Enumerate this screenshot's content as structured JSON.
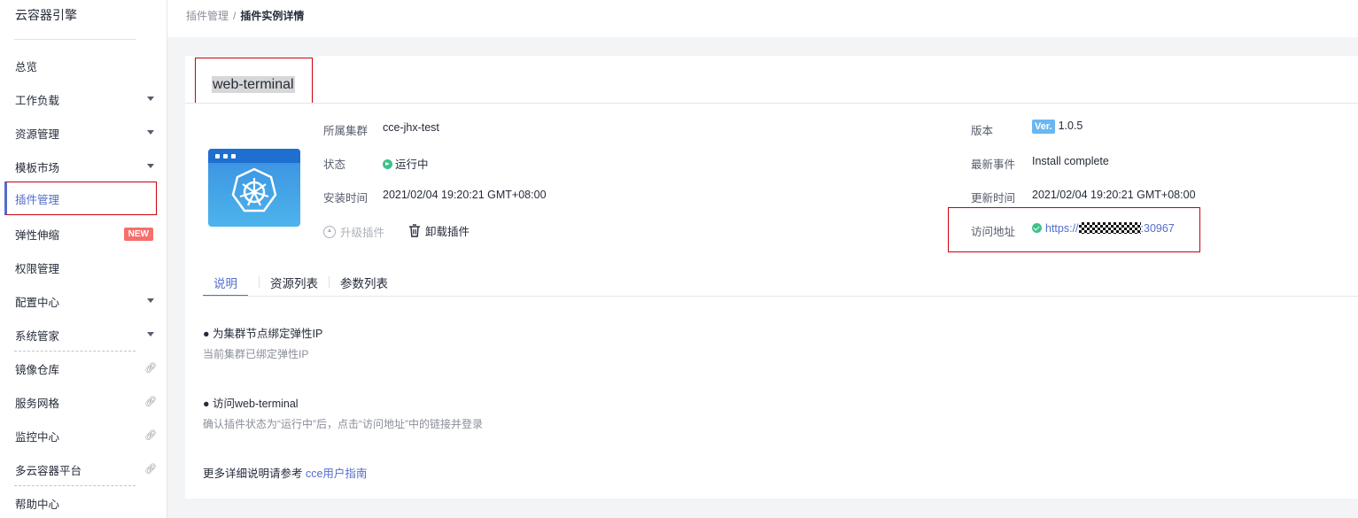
{
  "sidebar": {
    "title": "云容器引擎",
    "items": [
      {
        "label": "总览"
      },
      {
        "label": "工作负载"
      },
      {
        "label": "资源管理"
      },
      {
        "label": "模板市场"
      },
      {
        "label": "插件管理"
      },
      {
        "label": "弹性伸缩",
        "badge": "NEW"
      },
      {
        "label": "权限管理"
      },
      {
        "label": "配置中心"
      },
      {
        "label": "系统管家"
      },
      {
        "label": "镜像仓库"
      },
      {
        "label": "服务网格"
      },
      {
        "label": "监控中心"
      },
      {
        "label": "多云容器平台"
      },
      {
        "label": "帮助中心"
      }
    ]
  },
  "breadcrumb": {
    "parent": "插件管理",
    "separator": "/",
    "current": "插件实例详情"
  },
  "plugin": {
    "name": "web-terminal",
    "cluster_label": "所属集群",
    "cluster_value": "cce-jhx-test",
    "status_label": "状态",
    "status_value": "运行中",
    "install_time_label": "安装时间",
    "install_time_value": "2021/02/04 19:20:21 GMT+08:00",
    "version_label": "版本",
    "version_badge": "Ver.",
    "version_value": "1.0.5",
    "event_label": "最新事件",
    "event_value": "Install complete",
    "update_time_label": "更新时间",
    "update_time_value": "2021/02/04 19:20:21 GMT+08:00",
    "access_label": "访问地址",
    "access_prefix": "https://",
    "access_suffix": ":30967"
  },
  "actions": {
    "upgrade": "升级插件",
    "uninstall": "卸载插件"
  },
  "tabs": [
    {
      "label": "说明"
    },
    {
      "label": "资源列表"
    },
    {
      "label": "参数列表"
    }
  ],
  "description": {
    "section1_title": "● 为集群节点绑定弹性IP",
    "section1_text": "当前集群已绑定弹性IP",
    "section2_title": "● 访问web-terminal",
    "section2_text": "确认插件状态为“运行中”后，点击“访问地址”中的链接并登录",
    "more_prefix": "更多详细说明请参考 ",
    "more_link": "cce用户指南"
  },
  "colors": {
    "accent": "#526ecc",
    "highlight_border": "#c7000b",
    "success": "#3fbf8b",
    "badge_new": "#f66f6a"
  }
}
